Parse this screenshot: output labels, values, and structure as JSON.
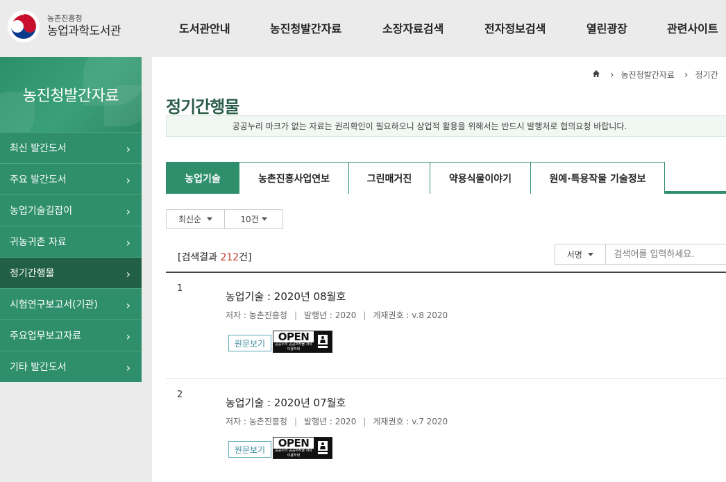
{
  "header": {
    "logo_sub": "농촌진흥청",
    "logo_main": "농업과학도서관",
    "nav": [
      "도서관안내",
      "농진청발간자료",
      "소장자료검색",
      "전자정보검색",
      "열린광장",
      "관련사이트"
    ]
  },
  "sidebar": {
    "title": "농진청발간자료",
    "items": [
      {
        "label": "최신 발간도서"
      },
      {
        "label": "주요 발간도서"
      },
      {
        "label": "농업기술길잡이"
      },
      {
        "label": "귀농귀촌 자료"
      },
      {
        "label": "정기간행물"
      },
      {
        "label": "시험연구보고서(기관)"
      },
      {
        "label": "주요업무보고자료"
      },
      {
        "label": "기타 발간도서"
      }
    ],
    "active_index": 4
  },
  "breadcrumb": {
    "items": [
      "농진청발간자료",
      "정기간"
    ]
  },
  "page": {
    "title": "정기간행물",
    "notice": "공공누리 마크가 없는 자료는 권리확인이 필요하오니 상업적 활용을 위해서는 반드시 발행처로 협의요청 바랍니다."
  },
  "tabs": [
    {
      "label": "농업기술"
    },
    {
      "label": "농촌진흥사업연보"
    },
    {
      "label": "그린매거진"
    },
    {
      "label": "약용식물이야기"
    },
    {
      "label": "원예·특용작물 기술정보"
    }
  ],
  "filters": {
    "sort": "최신순",
    "count": "10건"
  },
  "results": {
    "prefix": "[검색결과 ",
    "count": "212",
    "suffix": "건]"
  },
  "search": {
    "field": "서명",
    "placeholder": "검색어를 입력하세요."
  },
  "items": [
    {
      "no": "1",
      "title": "농업기술 : 2020년 08월호",
      "author": "저자 : 농촌진흥청",
      "year": "발행년 : 2020",
      "volume": "게재권호 : v.8 2020",
      "view_label": "원문보기",
      "open_label": "OPEN",
      "open_sub": "공공누리 공공저작물 자유이용허락"
    },
    {
      "no": "2",
      "title": "농업기술 : 2020년 07월호",
      "author": "저자 : 농촌진흥청",
      "year": "발행년 : 2020",
      "volume": "게재권호 : v.7 2020",
      "view_label": "원문보기",
      "open_label": "OPEN",
      "open_sub": "공공누리 공공저작물 자유이용허락"
    }
  ],
  "colors": {
    "brand_green": "#2f8f6c",
    "active_green": "#215f47",
    "title_green": "#2a5c4a",
    "accent_red": "#c0392b"
  },
  "icons": {
    "home": "home-icon",
    "chevron": "chevron-right-icon",
    "caret": "caret-down-icon"
  }
}
